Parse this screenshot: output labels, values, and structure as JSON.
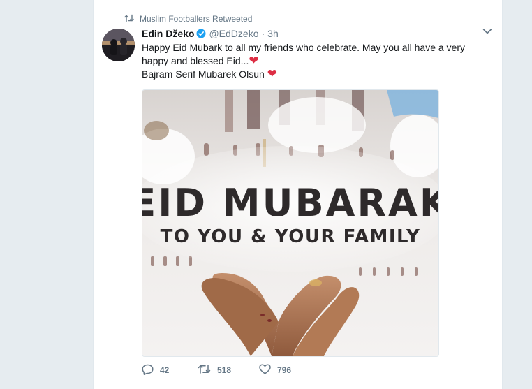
{
  "context": {
    "retweeter": "Muslim Footballers Retweeted",
    "icon": "retweet-icon"
  },
  "tweet": {
    "name": "Edin Džeko",
    "handle": "@EdDzeko",
    "separator": "·",
    "time": "3h",
    "line1": "Happy Eid Mubark to all my friends who celebrate. May you all have a very happy and blessed Eid...",
    "line2": "Bajram Serif Mubarek Olsun",
    "heart": "❤"
  },
  "media": {
    "title": "EID MUBARAK",
    "subtitle": "TO YOU & YOUR FAMILY"
  },
  "actions": {
    "replies": "42",
    "retweets": "518",
    "likes": "796"
  },
  "colors": {
    "verified": "#1da1f2",
    "heart": "#dd2e44",
    "muted": "#657786",
    "page_background": "#e6ecf0"
  }
}
